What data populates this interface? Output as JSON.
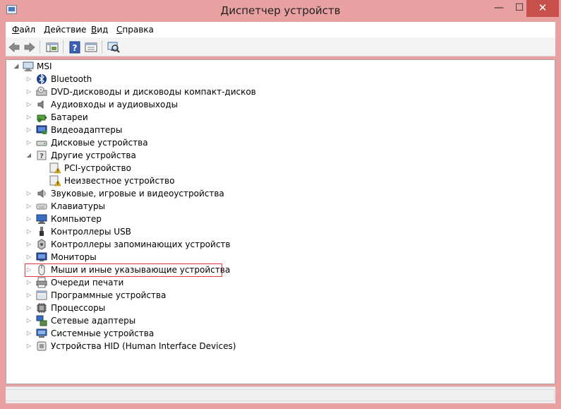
{
  "window": {
    "title": "Диспетчер устройств",
    "controls": {
      "minimize": "—",
      "maximize": "☐",
      "close": "✕"
    }
  },
  "menu": [
    {
      "label": "Файл",
      "key": "Ф",
      "rest": "айл"
    },
    {
      "label": "Действие",
      "key": "Д",
      "rest": "ействие"
    },
    {
      "label": "Вид",
      "key": "В",
      "rest": "ид"
    },
    {
      "label": "Справка",
      "key": "С",
      "rest": "правка"
    }
  ],
  "toolbar": {
    "buttons": [
      "back-icon",
      "forward-icon",
      "console-tree-icon",
      "help-icon",
      "properties-icon",
      "scan-hardware-icon"
    ]
  },
  "tree": {
    "root": "MSI",
    "items": [
      {
        "label": "Bluetooth",
        "icon": "bluetooth-icon",
        "expander": "▷"
      },
      {
        "label": "DVD-дисководы и дисководы компакт-дисков",
        "icon": "dvd-drive-icon",
        "expander": "▷"
      },
      {
        "label": "Аудиовходы и аудиовыходы",
        "icon": "audio-io-icon",
        "expander": "▷"
      },
      {
        "label": "Батареи",
        "icon": "battery-icon",
        "expander": "▷"
      },
      {
        "label": "Видеоадаптеры",
        "icon": "display-adapter-icon",
        "expander": "▷"
      },
      {
        "label": "Дисковые устройства",
        "icon": "disk-drive-icon",
        "expander": "▷"
      },
      {
        "label": "Другие устройства",
        "icon": "other-devices-icon",
        "expander": "◢"
      },
      {
        "label": "Звуковые, игровые и видеоустройства",
        "icon": "sound-icon",
        "expander": "▷"
      },
      {
        "label": "Клавиатуры",
        "icon": "keyboard-icon",
        "expander": "▷"
      },
      {
        "label": "Компьютер",
        "icon": "computer-icon",
        "expander": "▷"
      },
      {
        "label": "Контроллеры USB",
        "icon": "usb-icon",
        "expander": "▷"
      },
      {
        "label": "Контроллеры запоминающих устройств",
        "icon": "storage-controller-icon",
        "expander": "▷"
      },
      {
        "label": "Мониторы",
        "icon": "monitor-icon",
        "expander": "▷"
      },
      {
        "label": "Мыши и иные указывающие устройства",
        "icon": "mouse-icon",
        "expander": "▷",
        "highlighted": true
      },
      {
        "label": "Очереди печати",
        "icon": "print-queue-icon",
        "expander": "▷"
      },
      {
        "label": "Программные устройства",
        "icon": "software-device-icon",
        "expander": "▷"
      },
      {
        "label": "Процессоры",
        "icon": "processor-icon",
        "expander": "▷"
      },
      {
        "label": "Сетевые адаптеры",
        "icon": "network-adapter-icon",
        "expander": "▷"
      },
      {
        "label": "Системные устройства",
        "icon": "system-device-icon",
        "expander": "▷"
      },
      {
        "label": "Устройства HID (Human Interface Devices)",
        "icon": "hid-icon",
        "expander": "▷"
      }
    ],
    "other_devices_children": [
      {
        "label": "PCI-устройство",
        "icon": "unknown-device-warning-icon"
      },
      {
        "label": "Неизвестное устройство",
        "icon": "unknown-device-warning-icon"
      }
    ]
  },
  "colors": {
    "frame": "#e8a0a0",
    "close_button": "#c7504a",
    "highlight_box": "#e0393e",
    "warning": "#f2c200"
  }
}
